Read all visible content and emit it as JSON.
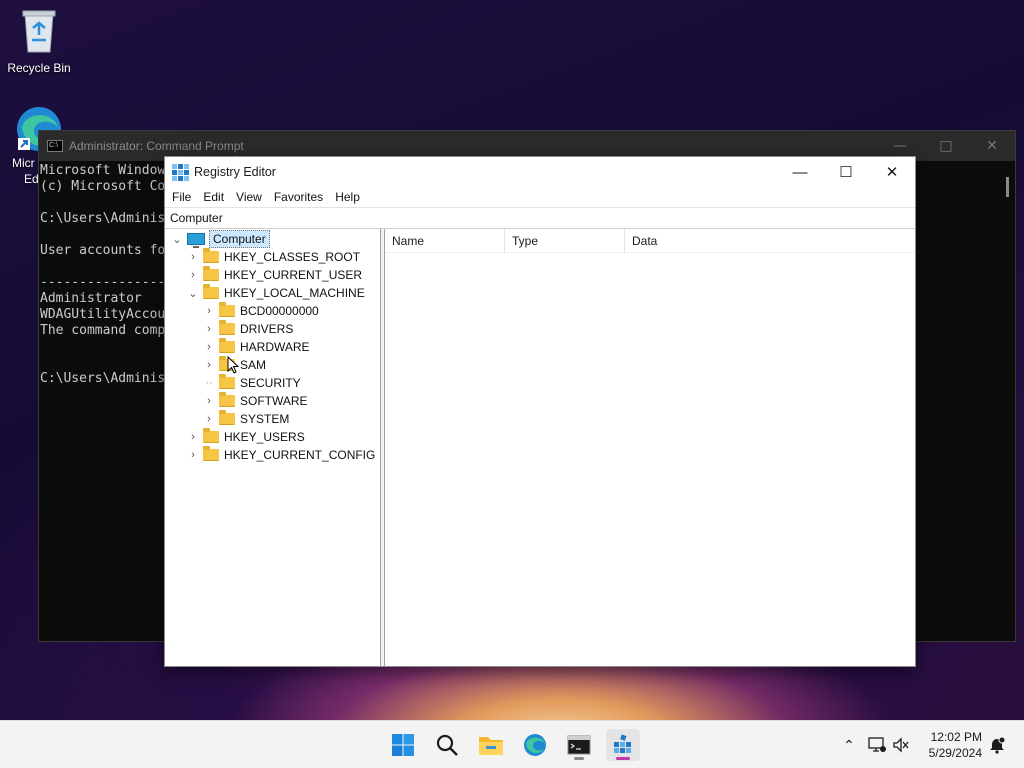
{
  "desktop": {
    "recycle_bin_label": "Recycle Bin",
    "edge_label_line1": "Micr",
    "edge_label_line2": "Ed"
  },
  "cmd_window": {
    "title": "Administrator: Command Prompt",
    "lines": [
      "Microsoft Window",
      "(c) Microsoft Co",
      "",
      "C:\\Users\\Adminis",
      "",
      "User accounts fo",
      "",
      "----------------",
      "Administrator",
      "WDAGUtilityAccou",
      "The command comp",
      "",
      "",
      "C:\\Users\\Adminis"
    ]
  },
  "regedit": {
    "title": "Registry Editor",
    "menu": [
      "File",
      "Edit",
      "View",
      "Favorites",
      "Help"
    ],
    "address": "Computer",
    "tree": {
      "root": "Computer",
      "hives": [
        {
          "label": "HKEY_CLASSES_ROOT",
          "expanded": false
        },
        {
          "label": "HKEY_CURRENT_USER",
          "expanded": false
        },
        {
          "label": "HKEY_LOCAL_MACHINE",
          "expanded": true
        },
        {
          "label": "HKEY_USERS",
          "expanded": false
        },
        {
          "label": "HKEY_CURRENT_CONFIG",
          "expanded": false
        }
      ],
      "hklm_children": [
        {
          "label": "BCD00000000",
          "has_children": true
        },
        {
          "label": "DRIVERS",
          "has_children": true
        },
        {
          "label": "HARDWARE",
          "has_children": true
        },
        {
          "label": "SAM",
          "has_children": true
        },
        {
          "label": "SECURITY",
          "has_children": false
        },
        {
          "label": "SOFTWARE",
          "has_children": true
        },
        {
          "label": "SYSTEM",
          "has_children": true
        }
      ]
    },
    "columns": [
      "Name",
      "Type",
      "Data"
    ]
  },
  "taskbar": {
    "time": "12:02 PM",
    "date": "5/29/2024",
    "apps": [
      "start-icon",
      "search-icon",
      "file-explorer-icon",
      "edge-icon",
      "terminal-icon",
      "registry-editor-icon"
    ]
  }
}
